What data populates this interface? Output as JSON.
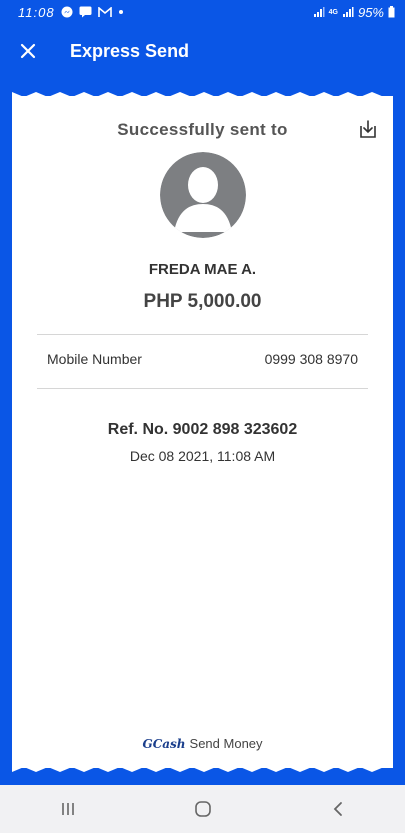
{
  "status_bar": {
    "time": "11:08",
    "battery": "95%",
    "network": "4G",
    "icons": [
      "messenger-icon",
      "chat-icon",
      "gmail-icon",
      "dot-icon",
      "signal-icon",
      "battery-icon"
    ]
  },
  "header": {
    "title": "Express Send",
    "close_icon": "close-icon"
  },
  "receipt": {
    "heading": "Successfully sent to",
    "download_icon": "download-icon",
    "recipient_name": "FREDA MAE A.",
    "amount": "PHP 5,000.00",
    "details": [
      {
        "label": "Mobile Number",
        "value": "0999 308 8970"
      }
    ],
    "reference": "Ref. No. 9002 898 323602",
    "date": "Dec 08 2021, 11:08 AM",
    "footer": {
      "brand": "GCash",
      "text": "Send Money"
    }
  },
  "nav": {
    "recent_icon": "recent-apps-icon",
    "home_icon": "home-icon",
    "back_icon": "back-icon"
  },
  "colors": {
    "primary": "#0a56e6",
    "card": "#ffffff",
    "text": "#333333"
  }
}
